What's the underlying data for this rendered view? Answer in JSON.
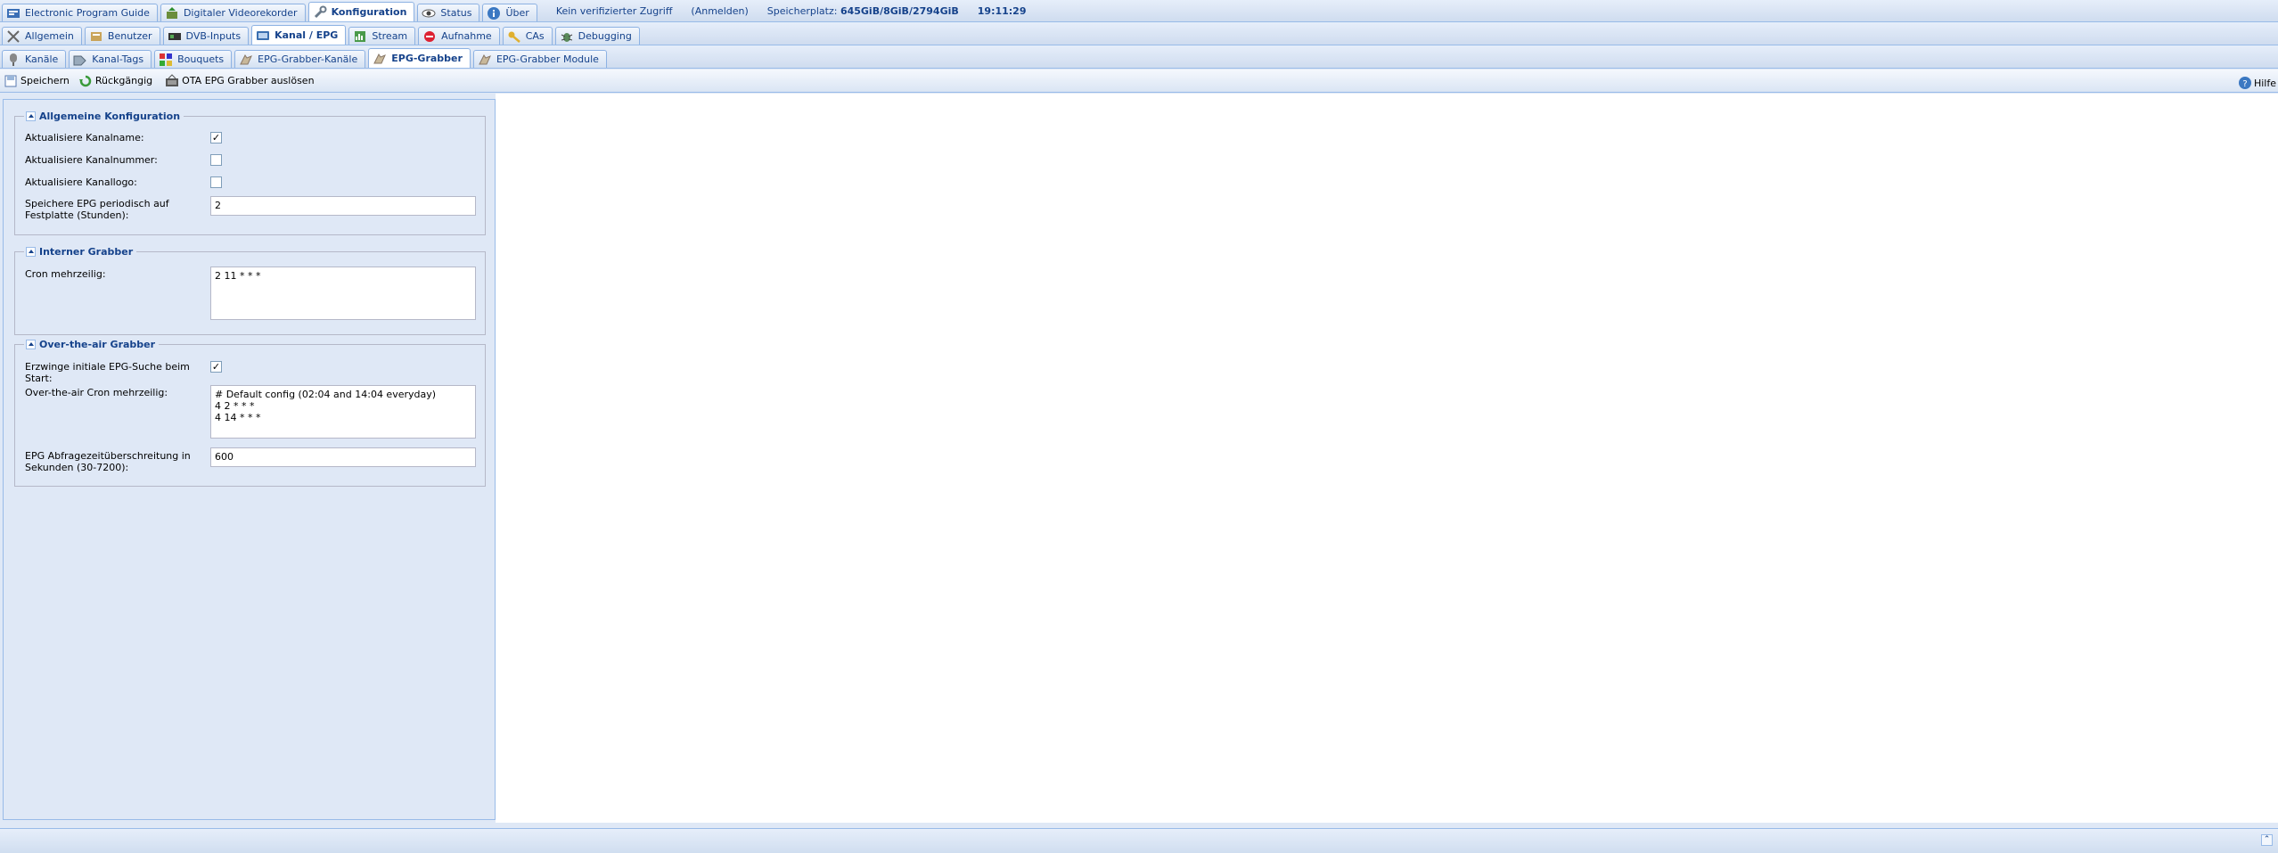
{
  "top_tabs": [
    {
      "label": "Electronic Program Guide",
      "icon": "epg-icon"
    },
    {
      "label": "Digitaler Videorekorder",
      "icon": "recorder-icon"
    },
    {
      "label": "Konfiguration",
      "icon": "wrench-icon"
    },
    {
      "label": "Status",
      "icon": "eye-icon"
    },
    {
      "label": "Über",
      "icon": "info-icon"
    }
  ],
  "header_info": {
    "access": "Kein verifizierter Zugriff",
    "login": "(Anmelden)",
    "storage_label": "Speicherplatz:",
    "storage_value": "645GiB/8GiB/2794GiB",
    "time": "19:11:29"
  },
  "config_tabs": [
    {
      "label": "Allgemein",
      "icon": "tools-icon"
    },
    {
      "label": "Benutzer",
      "icon": "users-icon"
    },
    {
      "label": "DVB-Inputs",
      "icon": "dvb-icon"
    },
    {
      "label": "Kanal / EPG",
      "icon": "tv-icon"
    },
    {
      "label": "Stream",
      "icon": "stream-icon"
    },
    {
      "label": "Aufnahme",
      "icon": "record-icon"
    },
    {
      "label": "CAs",
      "icon": "key-icon"
    },
    {
      "label": "Debugging",
      "icon": "debug-icon"
    }
  ],
  "sub_tabs": [
    {
      "label": "Kanäle",
      "icon": "channel-icon"
    },
    {
      "label": "Kanal-Tags",
      "icon": "tag-icon"
    },
    {
      "label": "Bouquets",
      "icon": "bouquet-icon"
    },
    {
      "label": "EPG-Grabber-Kanäle",
      "icon": "grabber-icon"
    },
    {
      "label": "EPG-Grabber",
      "icon": "grabber-icon"
    },
    {
      "label": "EPG-Grabber Module",
      "icon": "grabber-icon"
    }
  ],
  "toolbar": {
    "save": "Speichern",
    "undo": "Rückgängig",
    "ota": "OTA EPG Grabber auslösen",
    "help": "Hilfe"
  },
  "general": {
    "legend": "Allgemeine Konfiguration",
    "update_name_label": "Aktualisiere Kanalname:",
    "update_name_checked": "✓",
    "update_number_label": "Aktualisiere Kanalnummer:",
    "update_number_checked": "",
    "update_logo_label": "Aktualisiere Kanallogo:",
    "update_logo_checked": "",
    "save_epg_label": "Speichere EPG periodisch auf Festplatte (Stunden):",
    "save_epg_value": "2"
  },
  "internal": {
    "legend": "Interner Grabber",
    "cron_label": "Cron mehrzeilig:",
    "cron_value": "2 11 * * *"
  },
  "ota": {
    "legend": "Over-the-air Grabber",
    "force_label": "Erzwinge initiale EPG-Suche beim Start:",
    "force_checked": "✓",
    "cron_label": "Over-the-air Cron mehrzeilig:",
    "cron_value": "# Default config (02:04 and 14:04 everyday)\n4 2 * * *\n4 14 * * *",
    "timeout_label": "EPG Abfragezeitüberschreitung in Sekunden (30-7200):",
    "timeout_value": "600"
  },
  "colors": {
    "accent": "#15428b",
    "panel_bg": "#dfe8f6",
    "border": "#99bbe8"
  }
}
